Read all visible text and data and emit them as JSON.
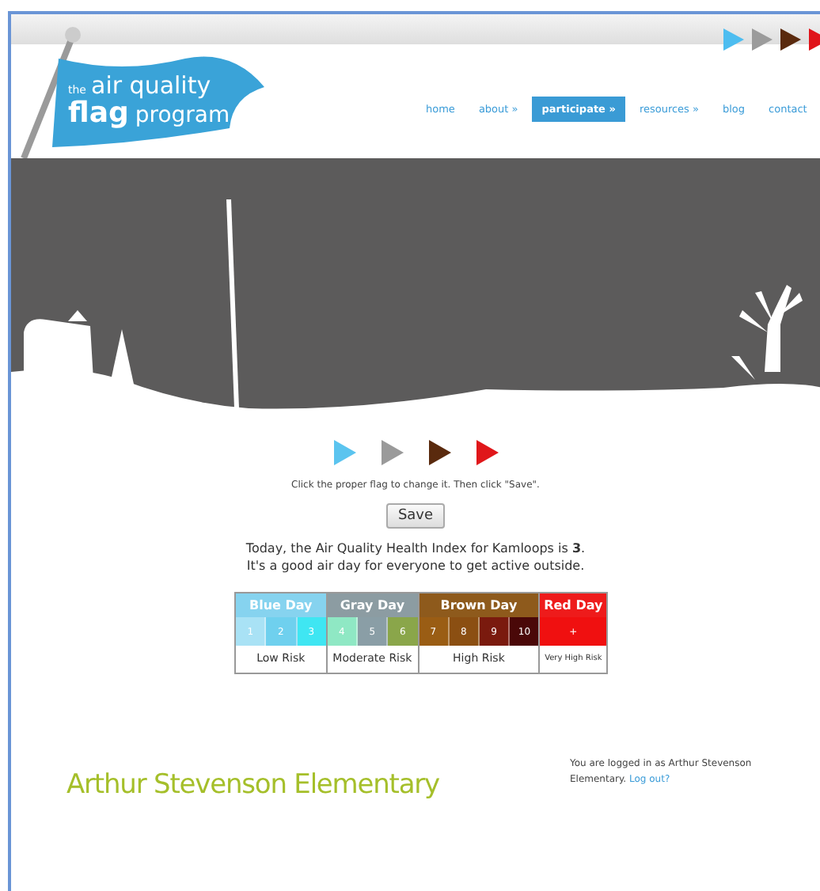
{
  "logo": {
    "small": "the",
    "line1": "air quality",
    "bold": "flag",
    "line2": "program"
  },
  "header_flags": [
    {
      "color": "#4dbdf0"
    },
    {
      "color": "#9b9b9b"
    },
    {
      "color": "#5a2a0e"
    },
    {
      "color": "#e0141a"
    }
  ],
  "nav": [
    {
      "label": "home",
      "selected": false
    },
    {
      "label": "about »",
      "selected": false
    },
    {
      "label": "participate »",
      "selected": true
    },
    {
      "label": "resources »",
      "selected": false
    },
    {
      "label": "blog",
      "selected": false
    },
    {
      "label": "contact",
      "selected": false
    }
  ],
  "flag_picker": [
    {
      "color": "#5bc4ef"
    },
    {
      "color": "#9a9a9a"
    },
    {
      "color": "#5a2a0e"
    },
    {
      "color": "#e0171a"
    }
  ],
  "instruction": "Click the proper flag to change it. Then click \"Save\".",
  "save_button": "Save",
  "index_sentence": "Today, the Air Quality Health Index for Kamloops is **3**.",
  "advice": "It's a good air day for everyone to get active outside.",
  "scale": [
    {
      "label": "Blue Day",
      "color": "#86d3ef",
      "risk": "Low Risk",
      "cells": [
        {
          "text": "1",
          "color": "#a9e2f5"
        },
        {
          "text": "2",
          "color": "#6fd0ee"
        },
        {
          "text": "3",
          "color": "#3fe6f2"
        }
      ]
    },
    {
      "label": "Gray Day",
      "color": "#8c9ca2",
      "risk": "Moderate Risk",
      "cells": [
        {
          "text": "4",
          "color": "#8fe8c4"
        },
        {
          "text": "5",
          "color": "#8a9ea6"
        },
        {
          "text": "6",
          "color": "#8aa64a"
        }
      ]
    },
    {
      "label": "Brown Day",
      "color": "#8e5a1c",
      "risk": "High Risk",
      "cells": [
        {
          "text": "7",
          "color": "#9a5d14"
        },
        {
          "text": "8",
          "color": "#8b4f12"
        },
        {
          "text": "9",
          "color": "#7a1a0e"
        },
        {
          "text": "10",
          "color": "#4a0808"
        }
      ]
    },
    {
      "label": "Red Day",
      "color": "#ee1b1b",
      "risk": "Very High Risk",
      "cells": [
        {
          "text": "+",
          "color": "#f01010"
        }
      ]
    }
  ],
  "school": "Arthur Stevenson Elementary",
  "login": {
    "text": "You are logged in as Arthur Stevenson Elementary.",
    "link": "Log out?"
  }
}
